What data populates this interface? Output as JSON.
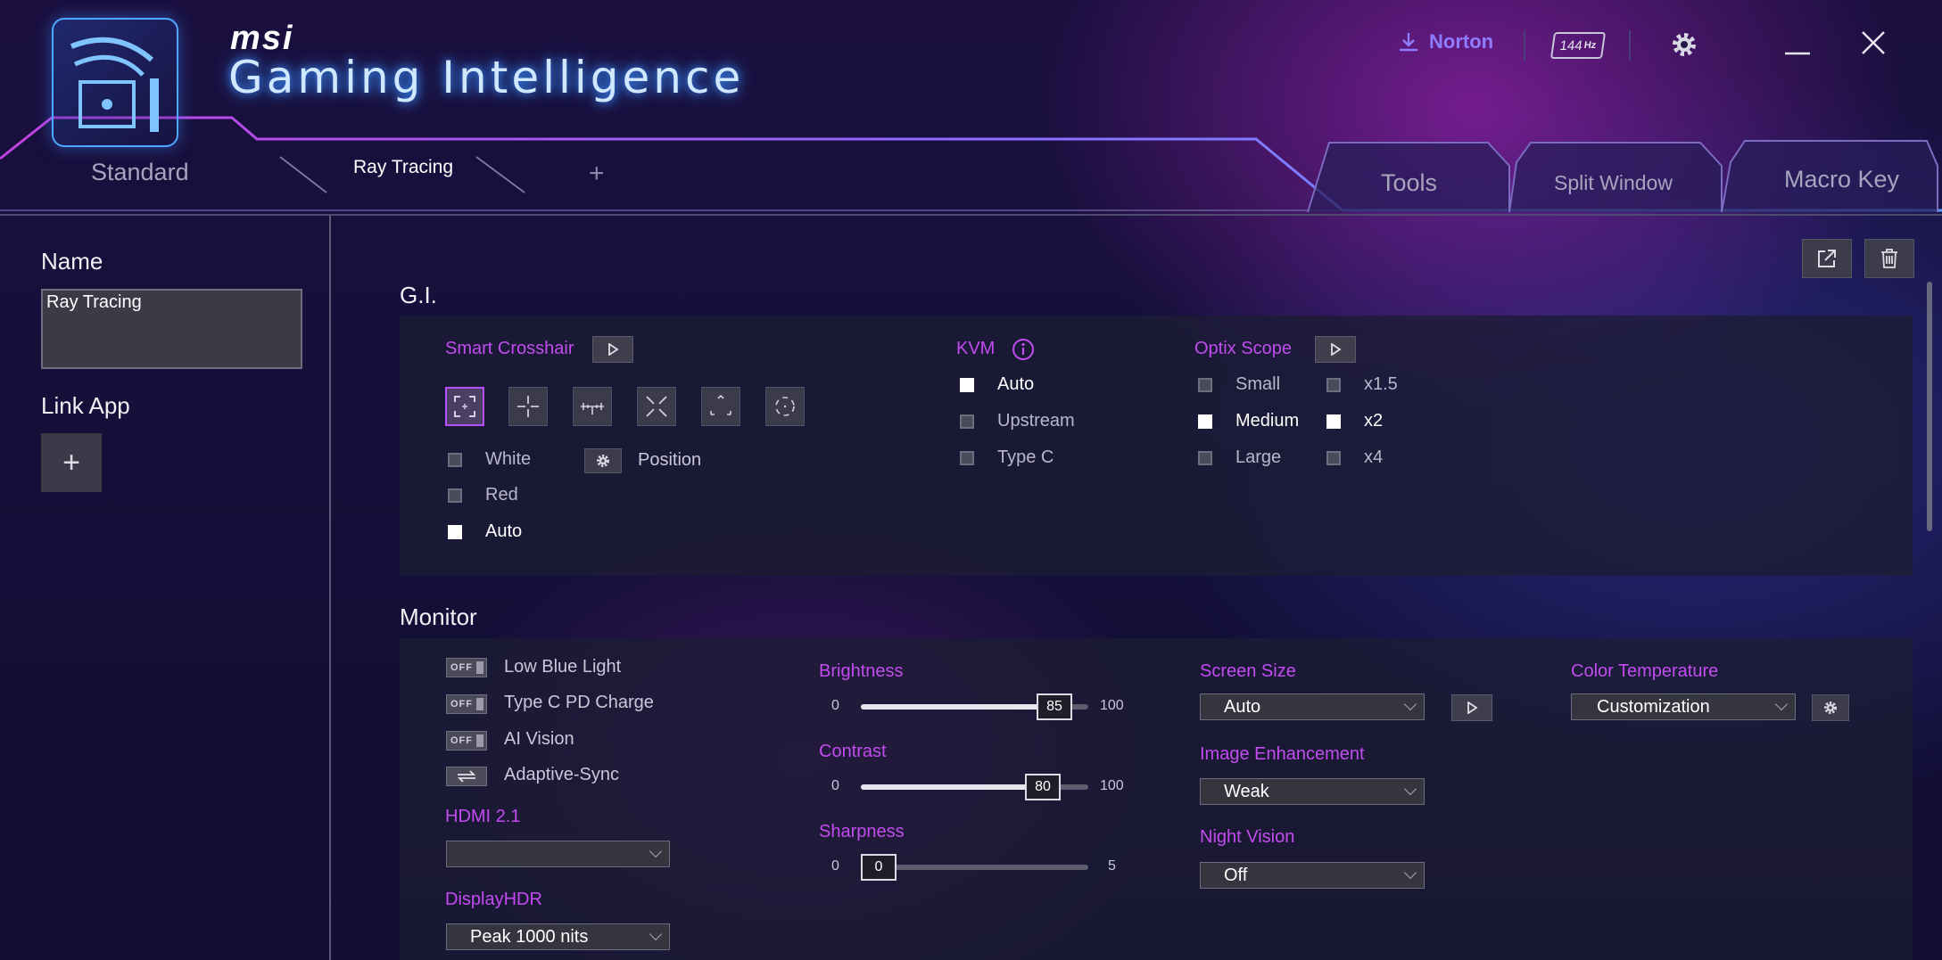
{
  "brand": {
    "msi": "msi",
    "title": "Gaming Intelligence"
  },
  "header": {
    "norton_label": "Norton",
    "refresh_rate_label": "144",
    "refresh_rate_unit": "Hz"
  },
  "tabs": {
    "left": [
      {
        "label": "Standard"
      },
      {
        "label": "Ray Tracing"
      }
    ],
    "add_symbol": "+",
    "right": [
      {
        "label": "Tools"
      },
      {
        "label": "Split Window"
      },
      {
        "label": "Macro Key"
      }
    ]
  },
  "sidebar": {
    "name_label": "Name",
    "name_value": "Ray Tracing",
    "link_app_label": "Link App",
    "add_symbol": "+"
  },
  "gi": {
    "title": "G.I.",
    "smart_crosshair": {
      "label": "Smart Crosshair",
      "styles_selected_index": 0,
      "colors": [
        {
          "label": "White",
          "checked": false
        },
        {
          "label": "Red",
          "checked": false
        },
        {
          "label": "Auto",
          "checked": true
        }
      ],
      "position_label": "Position"
    },
    "kvm": {
      "label": "KVM",
      "options": [
        {
          "label": "Auto",
          "checked": true
        },
        {
          "label": "Upstream",
          "checked": false
        },
        {
          "label": "Type C",
          "checked": false
        }
      ]
    },
    "optix_scope": {
      "label": "Optix Scope",
      "sizes": [
        {
          "label": "Small",
          "checked": false
        },
        {
          "label": "Medium",
          "checked": true
        },
        {
          "label": "Large",
          "checked": false
        }
      ],
      "zooms": [
        {
          "label": "x1.5",
          "checked": false
        },
        {
          "label": "x2",
          "checked": true
        },
        {
          "label": "x4",
          "checked": false
        }
      ]
    }
  },
  "monitor": {
    "title": "Monitor",
    "switches": [
      {
        "label": "Low Blue Light",
        "state": "OFF"
      },
      {
        "label": "Type C PD Charge",
        "state": "OFF"
      },
      {
        "label": "AI Vision",
        "state": "OFF"
      },
      {
        "label": "Adaptive-Sync",
        "state": "sync"
      }
    ],
    "hdmi": {
      "label": "HDMI 2.1",
      "value": ""
    },
    "display_hdr": {
      "label": "DisplayHDR",
      "value": "Peak 1000 nits"
    },
    "sliders": [
      {
        "label": "Brightness",
        "min": "0",
        "max": "100",
        "value": "85",
        "fraction": 0.85
      },
      {
        "label": "Contrast",
        "min": "0",
        "max": "100",
        "value": "80",
        "fraction": 0.8
      },
      {
        "label": "Sharpness",
        "min": "0",
        "max": "5",
        "value": "0",
        "fraction": 0.0
      }
    ],
    "screen_size": {
      "label": "Screen Size",
      "value": "Auto"
    },
    "image_enhancement": {
      "label": "Image Enhancement",
      "value": "Weak"
    },
    "night_vision": {
      "label": "Night Vision",
      "value": "Off"
    },
    "color_temperature": {
      "label": "Color Temperature",
      "value": "Customization"
    }
  },
  "colors": {
    "accent_purple": "#c24cf0",
    "brand_blue": "#4ea8ff",
    "norton": "#8f7dff"
  }
}
